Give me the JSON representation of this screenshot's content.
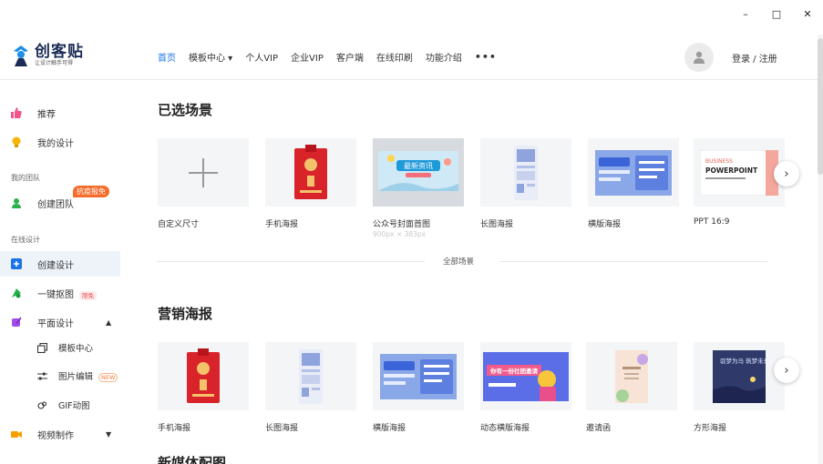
{
  "window": {
    "minimize": "–",
    "maximize": "□",
    "close": "✕"
  },
  "logo": {
    "name": "创客贴",
    "slogan": "让设计触手可得"
  },
  "nav": {
    "items": [
      "首页",
      "模板中心 ▾",
      "个人VIP",
      "企业VIP",
      "客户端",
      "在线印刷",
      "功能介绍"
    ],
    "more": "•••",
    "login": "登录 / 注册"
  },
  "sidebar": {
    "recommend": "推荐",
    "my_designs": "我的设计",
    "team_group": "我的团队",
    "create_team": "创建团队",
    "create_team_badge": "抗疫报免",
    "online_group": "在线设计",
    "create_design": "创建设计",
    "cutout": "一键抠图",
    "cutout_tag": "限免",
    "graphic_design": "平面设计",
    "graphic_caret": "▲",
    "template_center": "模板中心",
    "image_edit": "图片编辑",
    "image_edit_tag": "NEW",
    "gif": "GIF动图",
    "video": "视频制作",
    "video_caret": "▼"
  },
  "selected": {
    "title": "已选场景",
    "cards": [
      {
        "label": "自定义尺寸",
        "sub": ""
      },
      {
        "label": "手机海报",
        "sub": ""
      },
      {
        "label": "公众号封面首图",
        "sub": "900px × 383px"
      },
      {
        "label": "长图海报",
        "sub": ""
      },
      {
        "label": "横版海报",
        "sub": ""
      },
      {
        "label": "PPT 16:9",
        "sub": ""
      }
    ],
    "ppt_thumb": {
      "line1": "BUSINESS",
      "line2": "POWERPOINT"
    },
    "wechat_thumb": "最新资讯"
  },
  "all_scenes": "全部场景",
  "marketing": {
    "title": "营销海报",
    "cards": [
      {
        "label": "手机海报"
      },
      {
        "label": "长图海报"
      },
      {
        "label": "横版海报"
      },
      {
        "label": "动态横版海报"
      },
      {
        "label": "邀请函"
      },
      {
        "label": "方形海报"
      }
    ],
    "square_thumb": "驭梦为马 筑梦未来",
    "dynamic_thumb": "你有一份社团邀请"
  },
  "next_section": {
    "title": "新媒体配图"
  },
  "arrow": "›",
  "colors": {
    "accent": "#1a73e8",
    "badge": "#f56b2a",
    "logo_blue": "#1b8ee8"
  }
}
